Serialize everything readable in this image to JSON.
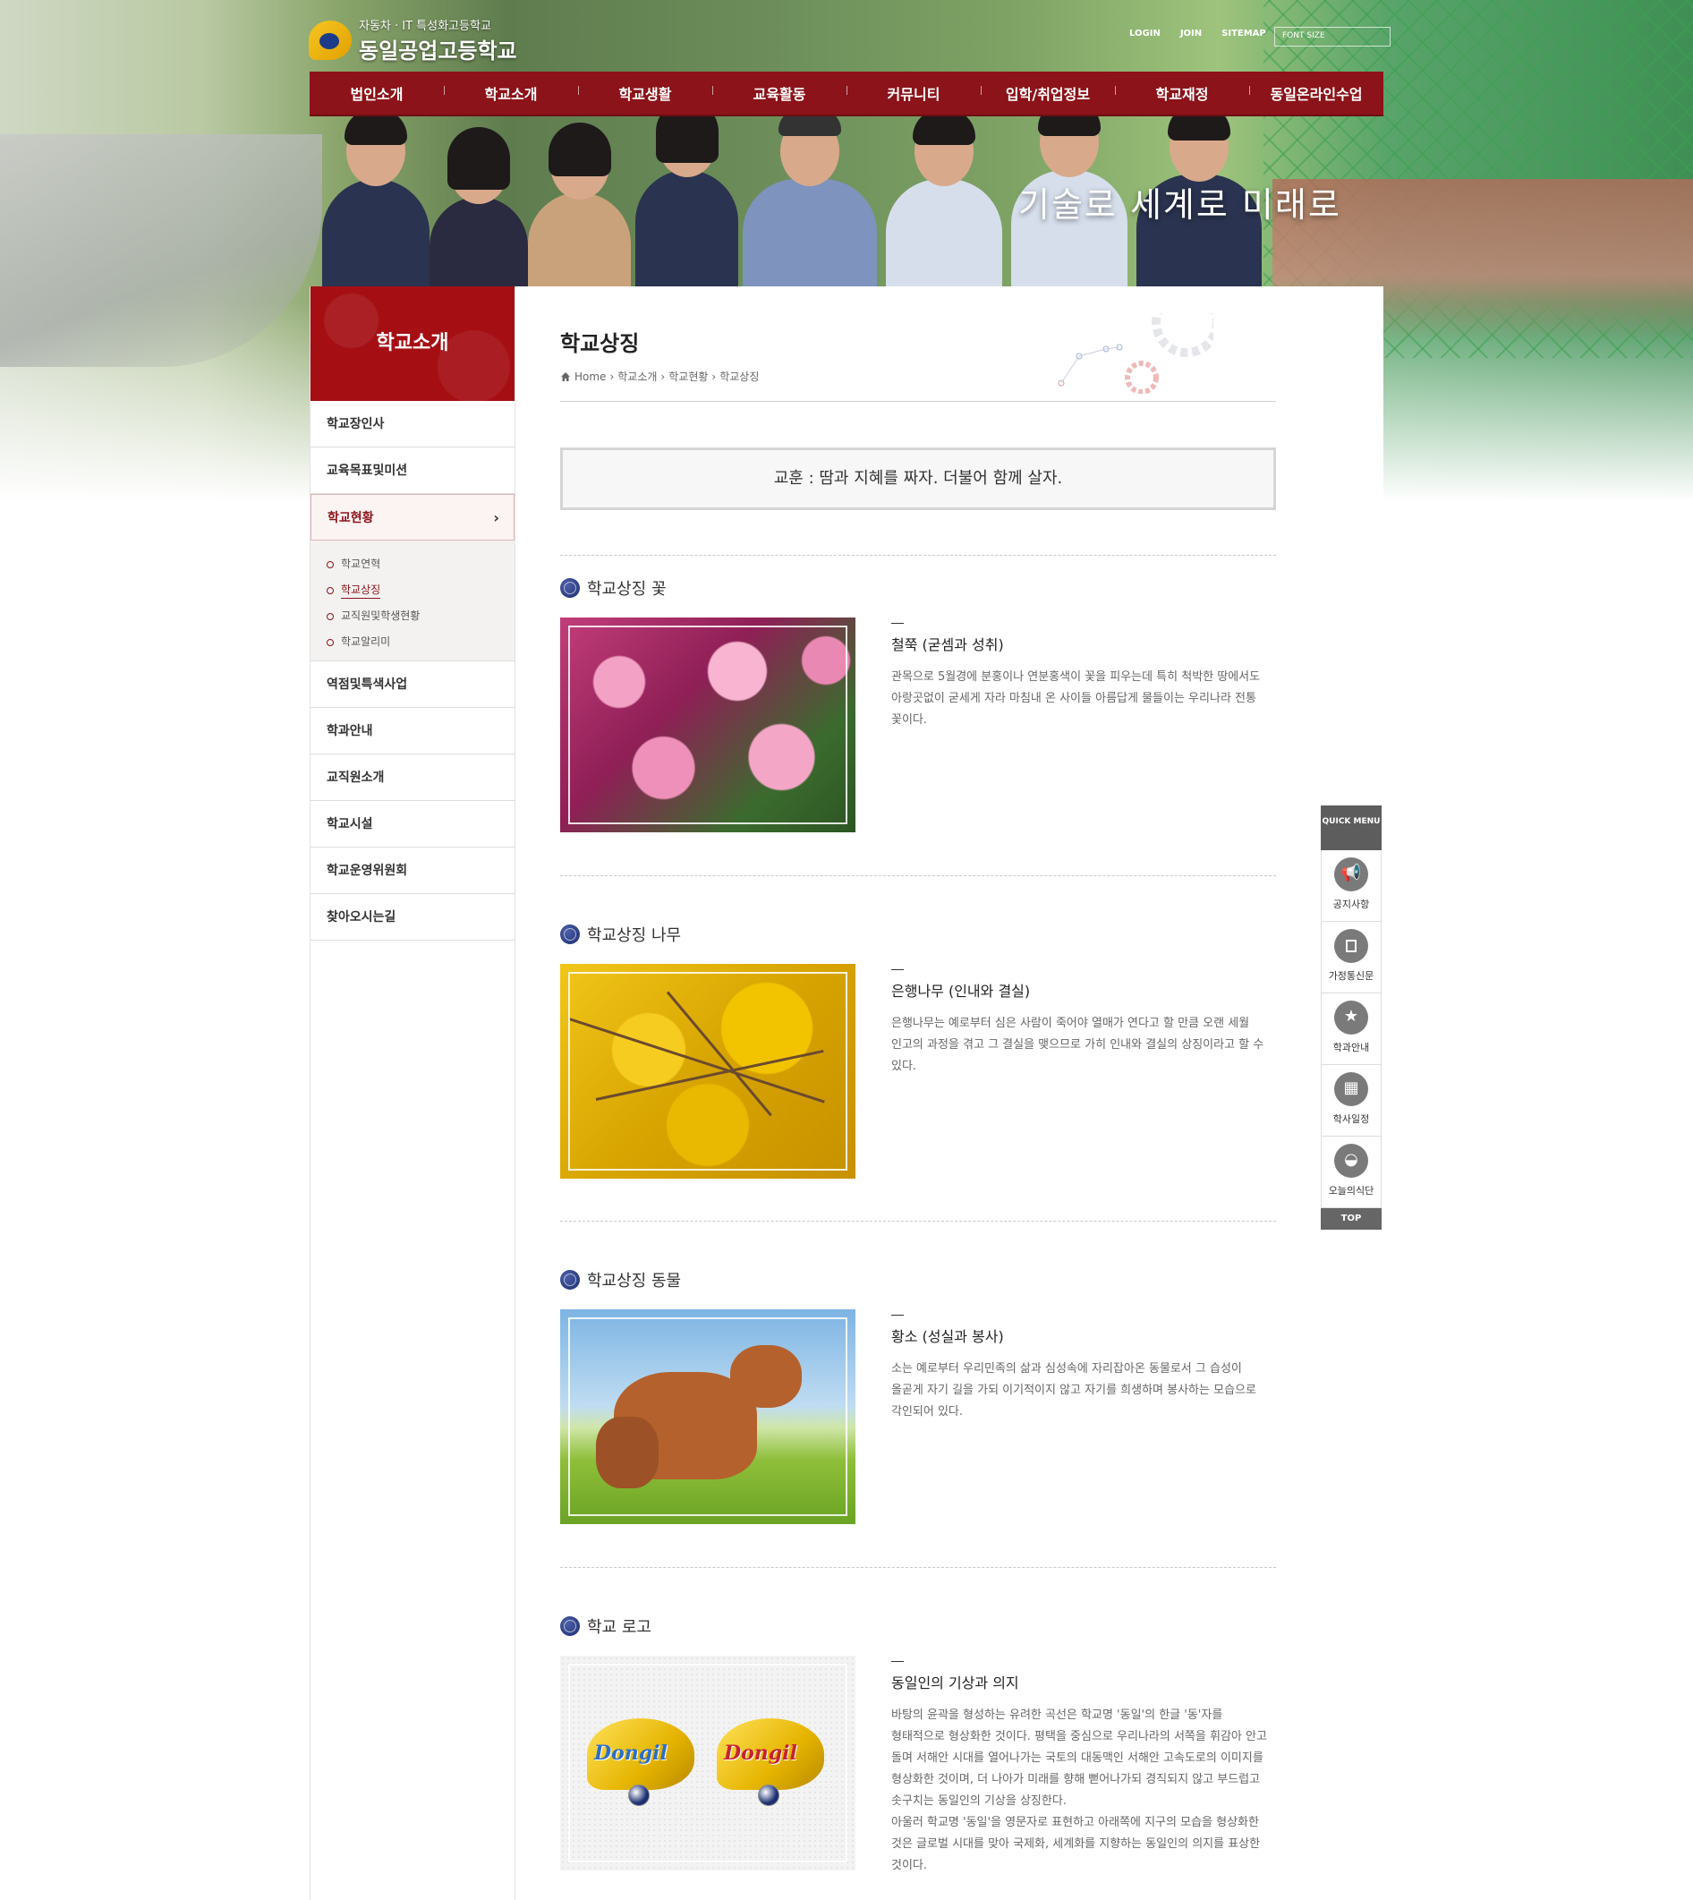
{
  "header": {
    "logo_sub": "자동차 · IT 특성화고등학교",
    "logo_name": "동일공업고등학교",
    "util": [
      "LOGIN",
      "JOIN",
      "SITEMAP"
    ],
    "font_size_label": "FONT SIZE",
    "slogan": "기술로 세계로 미래로"
  },
  "gnb": [
    "법인소개",
    "학교소개",
    "학교생활",
    "교육활동",
    "커뮤니티",
    "입학/취업정보",
    "학교재정",
    "동일온라인수업"
  ],
  "lnb": {
    "title": "학교소개",
    "items_top": [
      "학교장인사",
      "교육목표및미션"
    ],
    "active": "학교현황",
    "sub": [
      "학교연혁",
      "학교상징",
      "교직원및학생현황",
      "학교알리미"
    ],
    "sub_active_index": 1,
    "items_bottom": [
      "역점및특색사업",
      "학과안내",
      "교직원소개",
      "학교시설",
      "학교운영위원회",
      "찾아오시는길"
    ]
  },
  "main": {
    "page_title": "학교상징",
    "breadcrumb": [
      "Home",
      "학교소개",
      "학교현황",
      "학교상징"
    ],
    "motto": "교훈 : 땀과 지혜를 짜자. 더불어 함께 살자.",
    "sections": [
      {
        "title": "학교상징 꽃",
        "heading": "철쭉 (굳셈과 성취)",
        "body": "관목으로 5월경에 분홍이나 연분홍색이 꽃을 피우는데 특히 척박한 땅에서도 아랑곳없이 굳세게 자라 마침내 온 사이들 아름답게 물들이는 우리나라 전통 꽃이다."
      },
      {
        "title": "학교상징 나무",
        "heading": "은행나무 (인내와 결실)",
        "body": "은행나무는 예로부터 심은 사람이 죽어야 열매가 연다고 할 만큼 오랜 세월 인고의 과정을 겪고 그 결실을 맺으므로 가히 인내와 결실의 상징이라고 할 수 있다."
      },
      {
        "title": "학교상징 동물",
        "heading": "황소 (성실과 봉사)",
        "body": "소는 예로부터 우리민족의 삶과 심성속에 자리잡아온 동물로서 그 습성이 올곧게 자기 길을 가되 이기적이지 않고 자기를 희생하며 봉사하는 모습으로 각인되어 있다."
      },
      {
        "title": "학교 로고",
        "heading": "동일인의 기상과 의지",
        "body": "바탕의 윤곽을 형성하는 유려한 곡선은 학교명 '동일'의 한글 '동'자를 형태적으로 형상화한 것이다. 평택을 중심으로 우리나라의 서쪽을 휘감아 안고 돌며 서해안 시대를 열어나가는 국토의 대동맥인 서해안 고속도로의 이미지를 형상화한 것이며, 더 나아가 미래를 향해 뻗어나가되 경직되지 않고 부드럽고 솟구치는 동일인의 기상을 상징한다.",
        "body2": "아울러 학교명 '동일'을 영문자로 표현하고 아래쪽에 지구의 모습을 형상화한 것은 글로벌 시대를 맞아 국제화, 세계화를 지향하는 동일인의 의지를 표상한 것이다.",
        "logo_word": "Dongil"
      }
    ]
  },
  "quick": {
    "head": "QUICK MENU",
    "items": [
      "공지사항",
      "가정통신문",
      "학과안내",
      "학사일정",
      "오늘의식단"
    ],
    "top": "TOP"
  }
}
